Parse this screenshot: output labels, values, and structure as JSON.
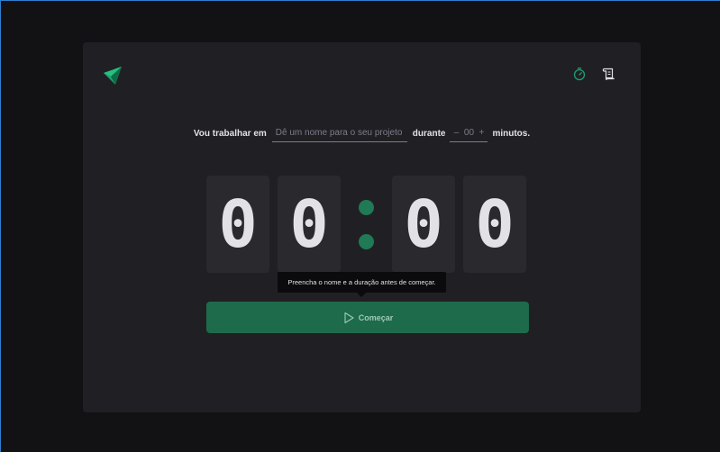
{
  "header": {
    "logo_icon": "play-arrow-logo",
    "nav": [
      {
        "icon": "timer-icon",
        "color": "#1f9e6e"
      },
      {
        "icon": "scroll-history-icon",
        "color": "#e1e1e6"
      }
    ]
  },
  "form": {
    "label_work": "Vou trabalhar em",
    "project_placeholder": "Dê um nome para o seu projeto",
    "label_during": "durante",
    "minus": "–",
    "minutes_value": "00",
    "plus": "+",
    "label_minutes": "minutos."
  },
  "countdown": {
    "digits": [
      "0",
      "0",
      "0",
      "0"
    ],
    "separator_color": "#1f7a55"
  },
  "tooltip": {
    "text": "Preencha o nome e a duração antes de começar."
  },
  "start_button": {
    "label": "Começar",
    "icon": "play-outline-icon",
    "color": "#1e6b4b"
  },
  "colors": {
    "background": "#121214",
    "card": "#202024",
    "accent": "#00875f"
  }
}
